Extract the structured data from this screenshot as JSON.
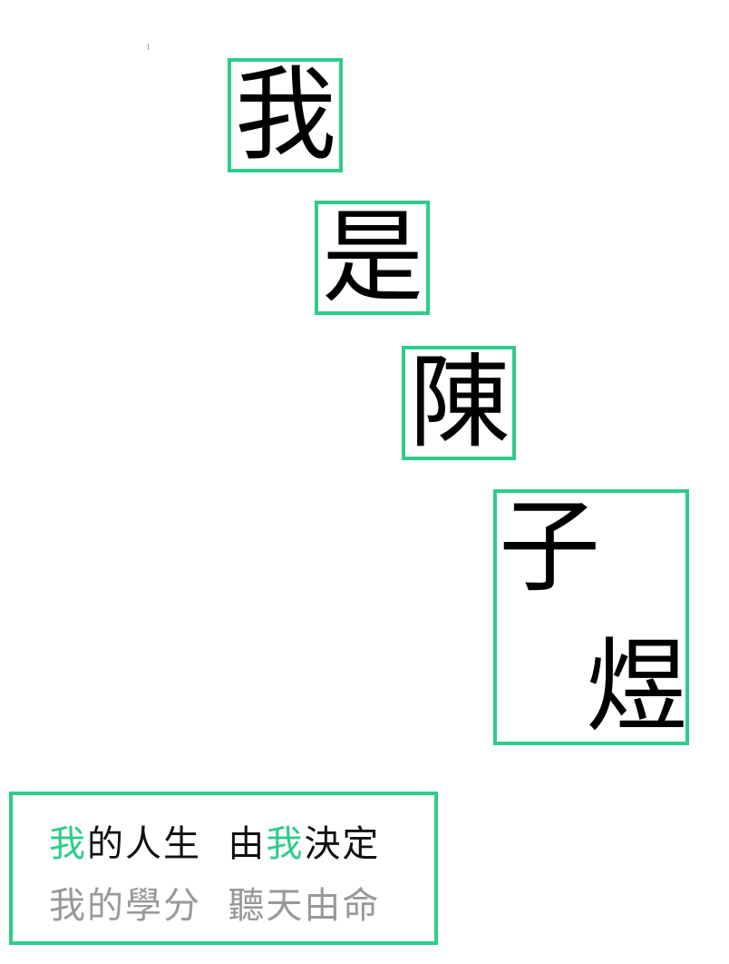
{
  "colors": {
    "accent": "#2ecc8a",
    "text": "#000000",
    "muted_text": "#999999",
    "background": "#ffffff"
  },
  "heading_chars": [
    "我",
    "是",
    "陳",
    "子",
    "煜"
  ],
  "quote": {
    "line1": {
      "part1": "我",
      "part2": "的人生  由",
      "part3": "我",
      "part4": "決定"
    },
    "line2": "我的學分  聽天由命"
  }
}
